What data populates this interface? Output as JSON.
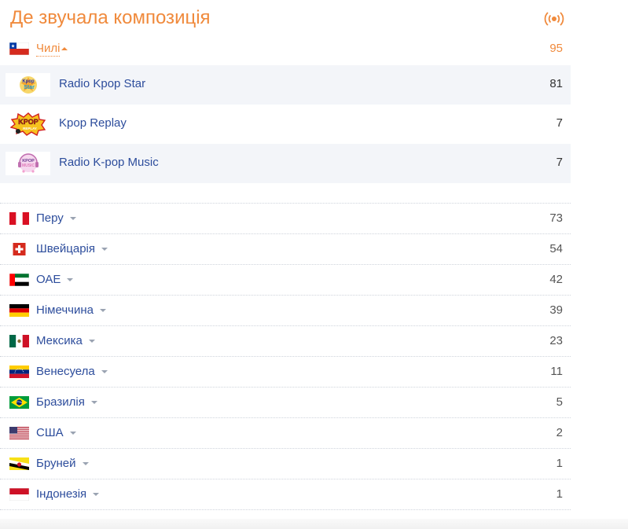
{
  "title": "Де звучала композиція",
  "icons": {
    "broadcast": "broadcast-icon"
  },
  "colors": {
    "accent": "#f08a3c",
    "link": "#2d4d9c"
  },
  "expanded_country": {
    "name": "Чилі",
    "count": "95",
    "stations": [
      {
        "name": "Radio Kpop Star",
        "count": "81"
      },
      {
        "name": "Kpop Replay",
        "count": "7"
      },
      {
        "name": "Radio K-pop Music",
        "count": "7"
      }
    ]
  },
  "countries": [
    {
      "name": "Перу",
      "count": "73"
    },
    {
      "name": "Швейцарія",
      "count": "54"
    },
    {
      "name": "ОАЕ",
      "count": "42"
    },
    {
      "name": "Німеччина",
      "count": "39"
    },
    {
      "name": "Мексика",
      "count": "23"
    },
    {
      "name": "Венесуела",
      "count": "11"
    },
    {
      "name": "Бразилія",
      "count": "5"
    },
    {
      "name": "США",
      "count": "2"
    },
    {
      "name": "Бруней",
      "count": "1"
    },
    {
      "name": "Індонезія",
      "count": "1"
    }
  ],
  "station_logos": {
    "0": {
      "text_top": "Kpop",
      "text_mid": "Star"
    },
    "1": {
      "text_top": "KPOP",
      "text_mid": "REPLAY"
    },
    "2": {
      "text_top": "KPOP",
      "text_mid": "MUSIC"
    }
  }
}
